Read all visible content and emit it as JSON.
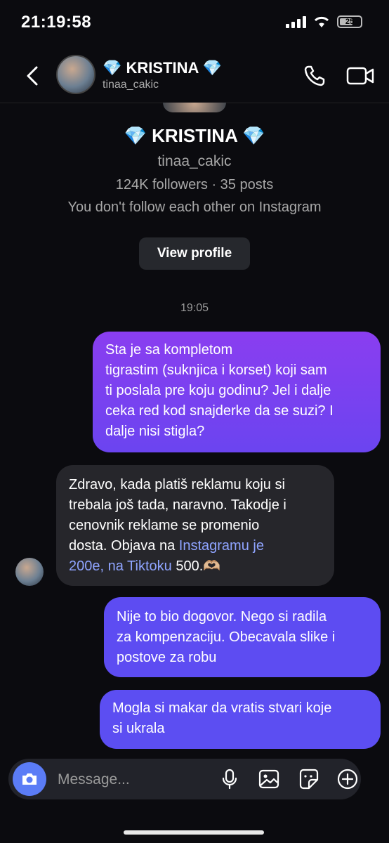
{
  "status_bar": {
    "time": "21:19:58",
    "battery": "25"
  },
  "header": {
    "name": "💎 KRISTINA 💎",
    "username": "tinaa_cakic",
    "back_icon": "chevron-left-icon",
    "call_icon": "phone-icon",
    "video_icon": "video-camera-icon"
  },
  "profile": {
    "name": "💎 KRISTINA 💎",
    "username": "tinaa_cakic",
    "stats": "124K followers · 35 posts",
    "follow_status": "You don't follow each other on Instagram",
    "view_profile_label": "View profile"
  },
  "timestamp": "19:05",
  "messages": [
    {
      "direction": "outgoing",
      "lines": [
        "Sta je sa kompletom",
        "tigrastim (suknjica i korset) koji sam",
        "ti poslala pre koju godinu? Jel i dalje",
        "ceka red kod snajderke da se suzi? I",
        "dalje nisi stigla?"
      ]
    },
    {
      "direction": "incoming",
      "lines": [
        "Zdravo, kada platiš reklamu koju si",
        "trebala još tada, naravno. Takodje i",
        "cenovnik reklame se promenio",
        "dosta. Objava na "
      ],
      "link1": "Instagramu je",
      "line5_link": "200e, na Tiktoku",
      "line5_rest": " 500.🫶🏼"
    },
    {
      "direction": "outgoing",
      "lines": [
        "Nije to bio dogovor. Nego si radila",
        "za kompenzaciju. Obecavala slike i",
        "postove za robu"
      ]
    },
    {
      "direction": "outgoing",
      "lines": [
        "Mogla si makar da vratis stvari koje",
        "si ukrala"
      ]
    }
  ],
  "composer": {
    "placeholder": "Message...",
    "icons": [
      "camera-icon",
      "microphone-icon",
      "image-icon",
      "sticker-icon",
      "plus-icon"
    ]
  },
  "colors": {
    "outgoing_top": "#8a3ef0",
    "outgoing_bottom": "#5d4cf2",
    "incoming": "#26262b",
    "link": "#8fa4ff",
    "camera_button": "#5b7cf6"
  }
}
